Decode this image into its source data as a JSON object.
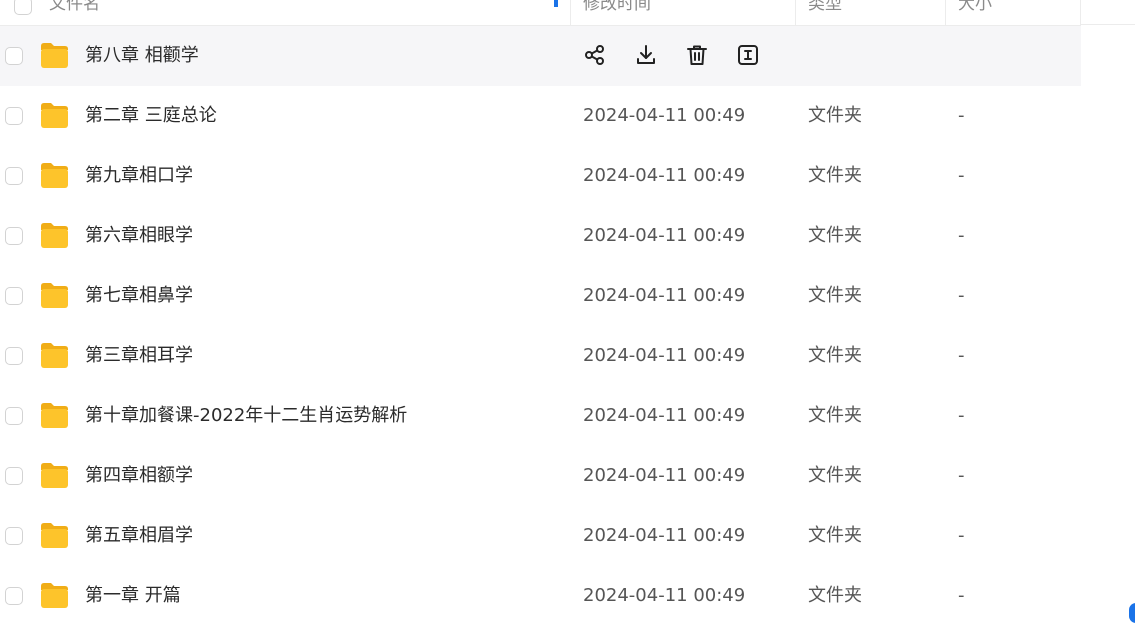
{
  "header": {
    "name_label": "文件名",
    "modified_label": "修改时间",
    "type_label": "类型",
    "size_label": "大小"
  },
  "colors": {
    "accent": "#1a73e8",
    "folder": "#fdc42b"
  },
  "rows": [
    {
      "name": "第八章 相颧学",
      "date": "",
      "type": "",
      "size": ""
    },
    {
      "name": "第二章 三庭总论",
      "date": "2024-04-11 00:49",
      "type": "文件夹",
      "size": "-"
    },
    {
      "name": "第九章相口学",
      "date": "2024-04-11 00:49",
      "type": "文件夹",
      "size": "-"
    },
    {
      "name": "第六章相眼学",
      "date": "2024-04-11 00:49",
      "type": "文件夹",
      "size": "-"
    },
    {
      "name": "第七章相鼻学",
      "date": "2024-04-11 00:49",
      "type": "文件夹",
      "size": "-"
    },
    {
      "name": "第三章相耳学",
      "date": "2024-04-11 00:49",
      "type": "文件夹",
      "size": "-"
    },
    {
      "name": "第十章加餐课-2022年十二生肖运势解析",
      "date": "2024-04-11 00:49",
      "type": "文件夹",
      "size": "-"
    },
    {
      "name": "第四章相额学",
      "date": "2024-04-11 00:49",
      "type": "文件夹",
      "size": "-"
    },
    {
      "name": "第五章相眉学",
      "date": "2024-04-11 00:49",
      "type": "文件夹",
      "size": "-"
    },
    {
      "name": "第一章 开篇",
      "date": "2024-04-11 00:49",
      "type": "文件夹",
      "size": "-"
    }
  ]
}
